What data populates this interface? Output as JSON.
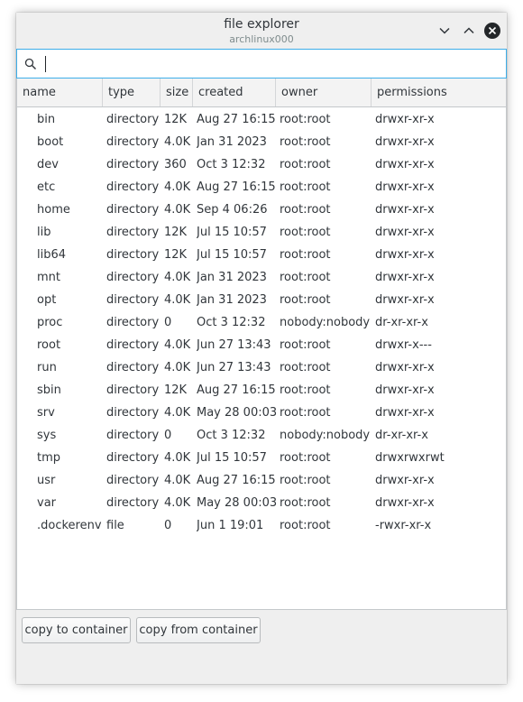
{
  "window": {
    "title": "file explorer",
    "subtitle": "archlinux000",
    "controls": [
      "chevron-down-icon",
      "chevron-up-icon",
      "close-icon"
    ]
  },
  "search": {
    "value": "",
    "placeholder": ""
  },
  "table": {
    "columns": [
      "name",
      "type",
      "size",
      "created",
      "owner",
      "permissions"
    ],
    "rows": [
      {
        "name": "bin",
        "type": "directory",
        "size": "12K",
        "created": "Aug 27 16:15",
        "owner": "root:root",
        "permissions": "drwxr-xr-x"
      },
      {
        "name": "boot",
        "type": "directory",
        "size": "4.0K",
        "created": "Jan 31 2023",
        "owner": "root:root",
        "permissions": "drwxr-xr-x"
      },
      {
        "name": "dev",
        "type": "directory",
        "size": "360",
        "created": "Oct 3 12:32",
        "owner": "root:root",
        "permissions": "drwxr-xr-x"
      },
      {
        "name": "etc",
        "type": "directory",
        "size": "4.0K",
        "created": "Aug 27 16:15",
        "owner": "root:root",
        "permissions": "drwxr-xr-x"
      },
      {
        "name": "home",
        "type": "directory",
        "size": "4.0K",
        "created": "Sep 4 06:26",
        "owner": "root:root",
        "permissions": "drwxr-xr-x"
      },
      {
        "name": "lib",
        "type": "directory",
        "size": "12K",
        "created": "Jul 15 10:57",
        "owner": "root:root",
        "permissions": "drwxr-xr-x"
      },
      {
        "name": "lib64",
        "type": "directory",
        "size": "12K",
        "created": "Jul 15 10:57",
        "owner": "root:root",
        "permissions": "drwxr-xr-x"
      },
      {
        "name": "mnt",
        "type": "directory",
        "size": "4.0K",
        "created": "Jan 31 2023",
        "owner": "root:root",
        "permissions": "drwxr-xr-x"
      },
      {
        "name": "opt",
        "type": "directory",
        "size": "4.0K",
        "created": "Jan 31 2023",
        "owner": "root:root",
        "permissions": "drwxr-xr-x"
      },
      {
        "name": "proc",
        "type": "directory",
        "size": "0",
        "created": "Oct 3 12:32",
        "owner": "nobody:nobody",
        "permissions": "dr-xr-xr-x"
      },
      {
        "name": "root",
        "type": "directory",
        "size": "4.0K",
        "created": "Jun 27 13:43",
        "owner": "root:root",
        "permissions": "drwxr-x---"
      },
      {
        "name": "run",
        "type": "directory",
        "size": "4.0K",
        "created": "Jun 27 13:43",
        "owner": "root:root",
        "permissions": "drwxr-xr-x"
      },
      {
        "name": "sbin",
        "type": "directory",
        "size": "12K",
        "created": "Aug 27 16:15",
        "owner": "root:root",
        "permissions": "drwxr-xr-x"
      },
      {
        "name": "srv",
        "type": "directory",
        "size": "4.0K",
        "created": "May 28 00:03",
        "owner": "root:root",
        "permissions": "drwxr-xr-x"
      },
      {
        "name": "sys",
        "type": "directory",
        "size": "0",
        "created": "Oct 3 12:32",
        "owner": "nobody:nobody",
        "permissions": "dr-xr-xr-x"
      },
      {
        "name": "tmp",
        "type": "directory",
        "size": "4.0K",
        "created": "Jul 15 10:57",
        "owner": "root:root",
        "permissions": "drwxrwxrwt"
      },
      {
        "name": "usr",
        "type": "directory",
        "size": "4.0K",
        "created": "Aug 27 16:15",
        "owner": "root:root",
        "permissions": "drwxr-xr-x"
      },
      {
        "name": "var",
        "type": "directory",
        "size": "4.0K",
        "created": "May 28 00:03",
        "owner": "root:root",
        "permissions": "drwxr-xr-x"
      },
      {
        "name": ".dockerenv",
        "type": "file",
        "size": "0",
        "created": "Jun 1 19:01",
        "owner": "root:root",
        "permissions": "-rwxr-xr-x"
      }
    ]
  },
  "actions": {
    "copy_to": "copy to container",
    "copy_from": "copy from container"
  },
  "colors": {
    "accent": "#3daee9",
    "window_bg": "#efefef",
    "text": "#31363b"
  }
}
